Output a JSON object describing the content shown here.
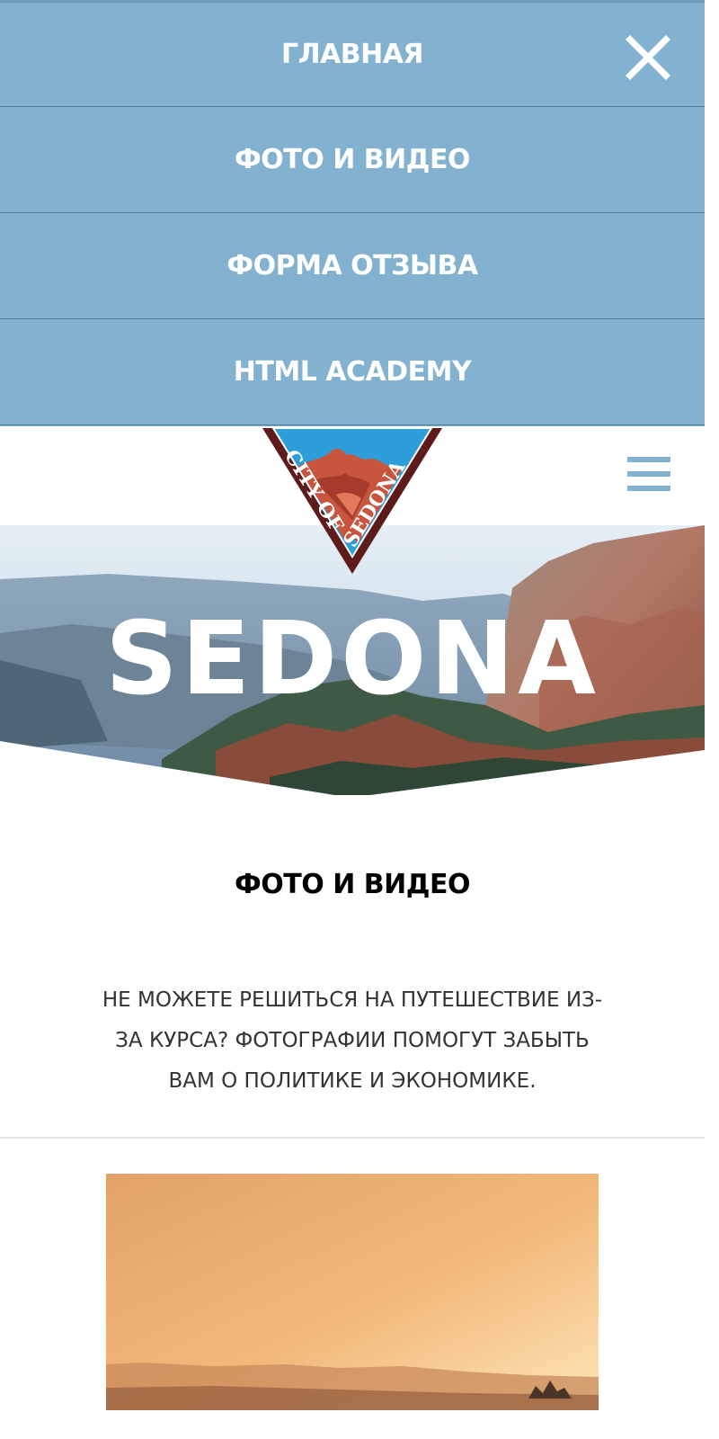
{
  "nav": {
    "items": [
      {
        "label": "ГЛАВНАЯ"
      },
      {
        "label": "ФОТО И ВИДЕО"
      },
      {
        "label": "ФОРМА ОТЗЫВА"
      },
      {
        "label": "HTML ACADEMY"
      }
    ],
    "close_icon": "close-icon"
  },
  "header": {
    "logo_text": "CITY OF SEDONA",
    "menu_icon": "hamburger-icon"
  },
  "hero": {
    "title": "SEDONA"
  },
  "section": {
    "title": "ФОТО И ВИДЕО",
    "text": "НЕ МОЖЕТЕ РЕШИТЬСЯ НА ПУТЕШЕСТВИЕ ИЗ-ЗА КУРСА? ФОТОГРАФИИ ПОМОГУТ ЗАБЫТЬ ВАМ О ПОЛИТИКЕ И ЭКОНОМИКЕ."
  },
  "colors": {
    "accent": "#82b2d0",
    "nav_border": "#4e7d99",
    "logo_maroon": "#5e1b1b",
    "logo_sky": "#2d9ed9",
    "logo_rock": "#c8553d"
  }
}
